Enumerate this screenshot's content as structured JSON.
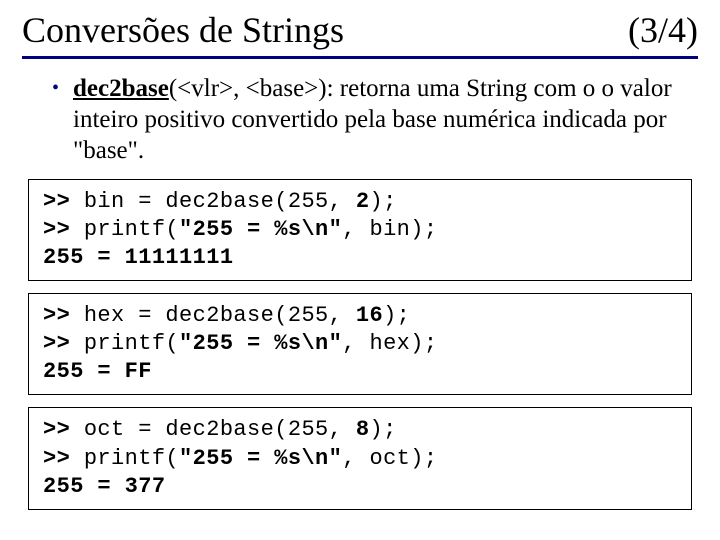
{
  "header": {
    "title_left": "Conversões de Strings",
    "title_right": "(3/4)"
  },
  "bullet": {
    "func_name": "dec2base",
    "rest_text": "(<vlr>, <base>): retorna uma String com o o valor inteiro positivo convertido pela base numérica indicada por \"base\"."
  },
  "code1": {
    "l1_prompt": ">> ",
    "l1_a": "bin = dec2base(255, ",
    "l1_b": "2",
    "l1_c": ");",
    "l2_prompt": ">> ",
    "l2_a": "printf(",
    "l2_b": "\"255 = %s\\n\"",
    "l2_c": ", bin);",
    "l3": "255 = 11111111"
  },
  "code2": {
    "l1_prompt": ">> ",
    "l1_a": "hex = dec2base(255, ",
    "l1_b": "16",
    "l1_c": ");",
    "l2_prompt": ">> ",
    "l2_a": "printf(",
    "l2_b": "\"255 = %s\\n\"",
    "l2_c": ", hex);",
    "l3": "255 = FF"
  },
  "code3": {
    "l1_prompt": ">> ",
    "l1_a": "oct = dec2base(255, ",
    "l1_b": "8",
    "l1_c": ");",
    "l2_prompt": ">> ",
    "l2_a": "printf(",
    "l2_b": "\"255 = %s\\n\"",
    "l2_c": ", oct);",
    "l3": "255 = 377"
  }
}
